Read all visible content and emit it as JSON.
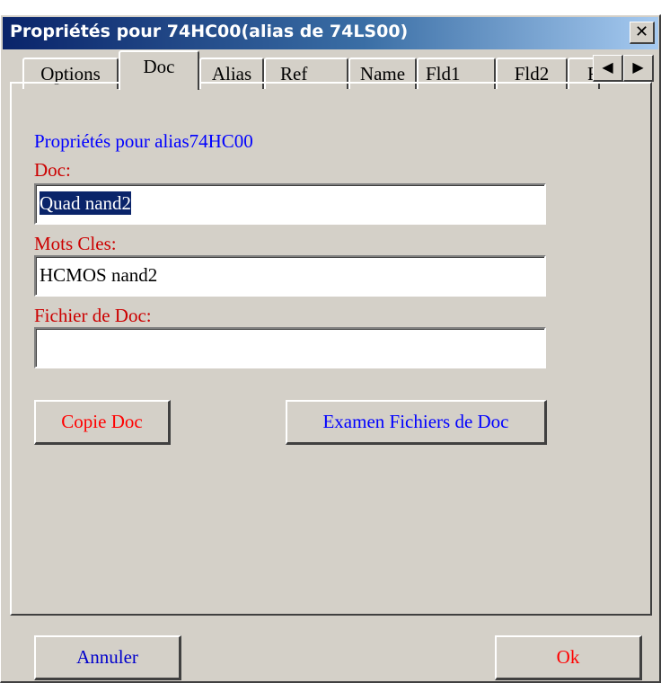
{
  "window": {
    "title": "Propriétés pour 74HC00(alias de 74LS00)",
    "close_glyph": "✕"
  },
  "tabs": [
    {
      "label": "Options",
      "active": false
    },
    {
      "label": "Doc",
      "active": true
    },
    {
      "label": "Alias",
      "active": false
    },
    {
      "label": "Ref",
      "active": false
    },
    {
      "label": "Name",
      "active": false
    },
    {
      "label": "Fld1",
      "active": false
    },
    {
      "label": "Fld2",
      "active": false
    },
    {
      "label": "F",
      "active": false
    }
  ],
  "tab_scroll": {
    "left_glyph": "◀",
    "right_glyph": "▶"
  },
  "doc_panel": {
    "header": "Propriétés pour alias74HC00",
    "doc_label": "Doc:",
    "doc_value": "Quad nand2",
    "keywords_label": "Mots Cles:",
    "keywords_value": "HCMOS nand2",
    "docfile_label": "Fichier de Doc:",
    "docfile_value": "",
    "copy_button": "Copie Doc",
    "browse_button": "Examen Fichiers de Doc"
  },
  "footer": {
    "cancel": "Annuler",
    "ok": "Ok"
  },
  "colors": {
    "title_gradient_start": "#0a246a",
    "dialog_bg": "#d4d0c8",
    "blue_text": "#0000ff",
    "red_text": "#cc0000",
    "selection": "#0a246a"
  }
}
